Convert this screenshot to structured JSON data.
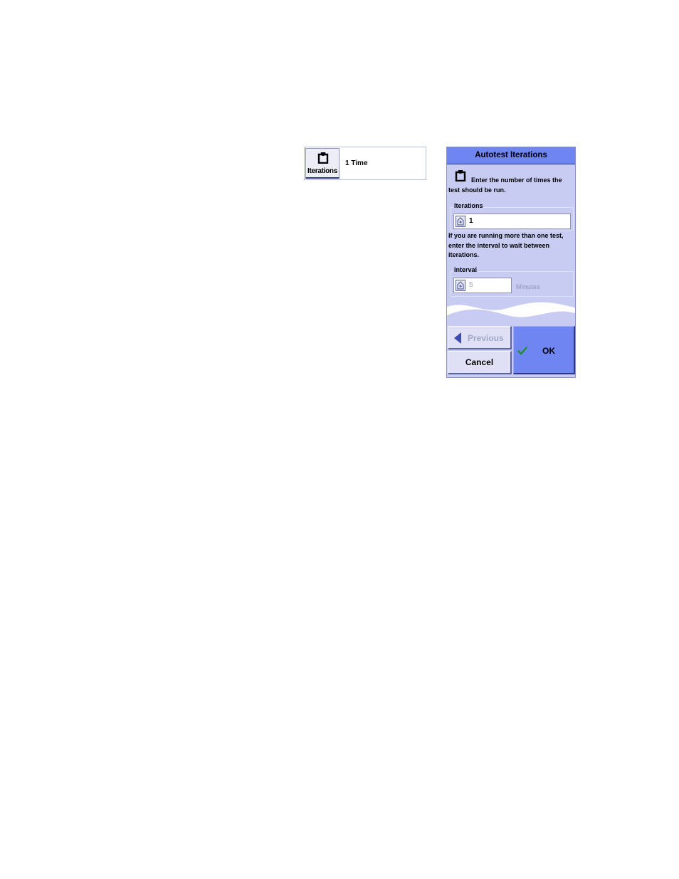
{
  "tile": {
    "label": "Iterations",
    "value": "1 Time",
    "icon": "iterations-icon"
  },
  "dialog": {
    "title": "Autotest Iterations",
    "instruction": "Enter the number of times the test should be run.",
    "iterations": {
      "label": "Iterations",
      "value": "1"
    },
    "interval_info": "If you are running more than one test, enter the interval to wait between iterations.",
    "interval": {
      "label": "Interval",
      "value": "5",
      "units": "Minutes"
    },
    "buttons": {
      "previous": "Previous",
      "cancel": "Cancel",
      "ok": "OK"
    },
    "colors": {
      "accent": "#6f86f0",
      "panel": "#c8cbf2",
      "check": "#1f8f2a"
    }
  }
}
